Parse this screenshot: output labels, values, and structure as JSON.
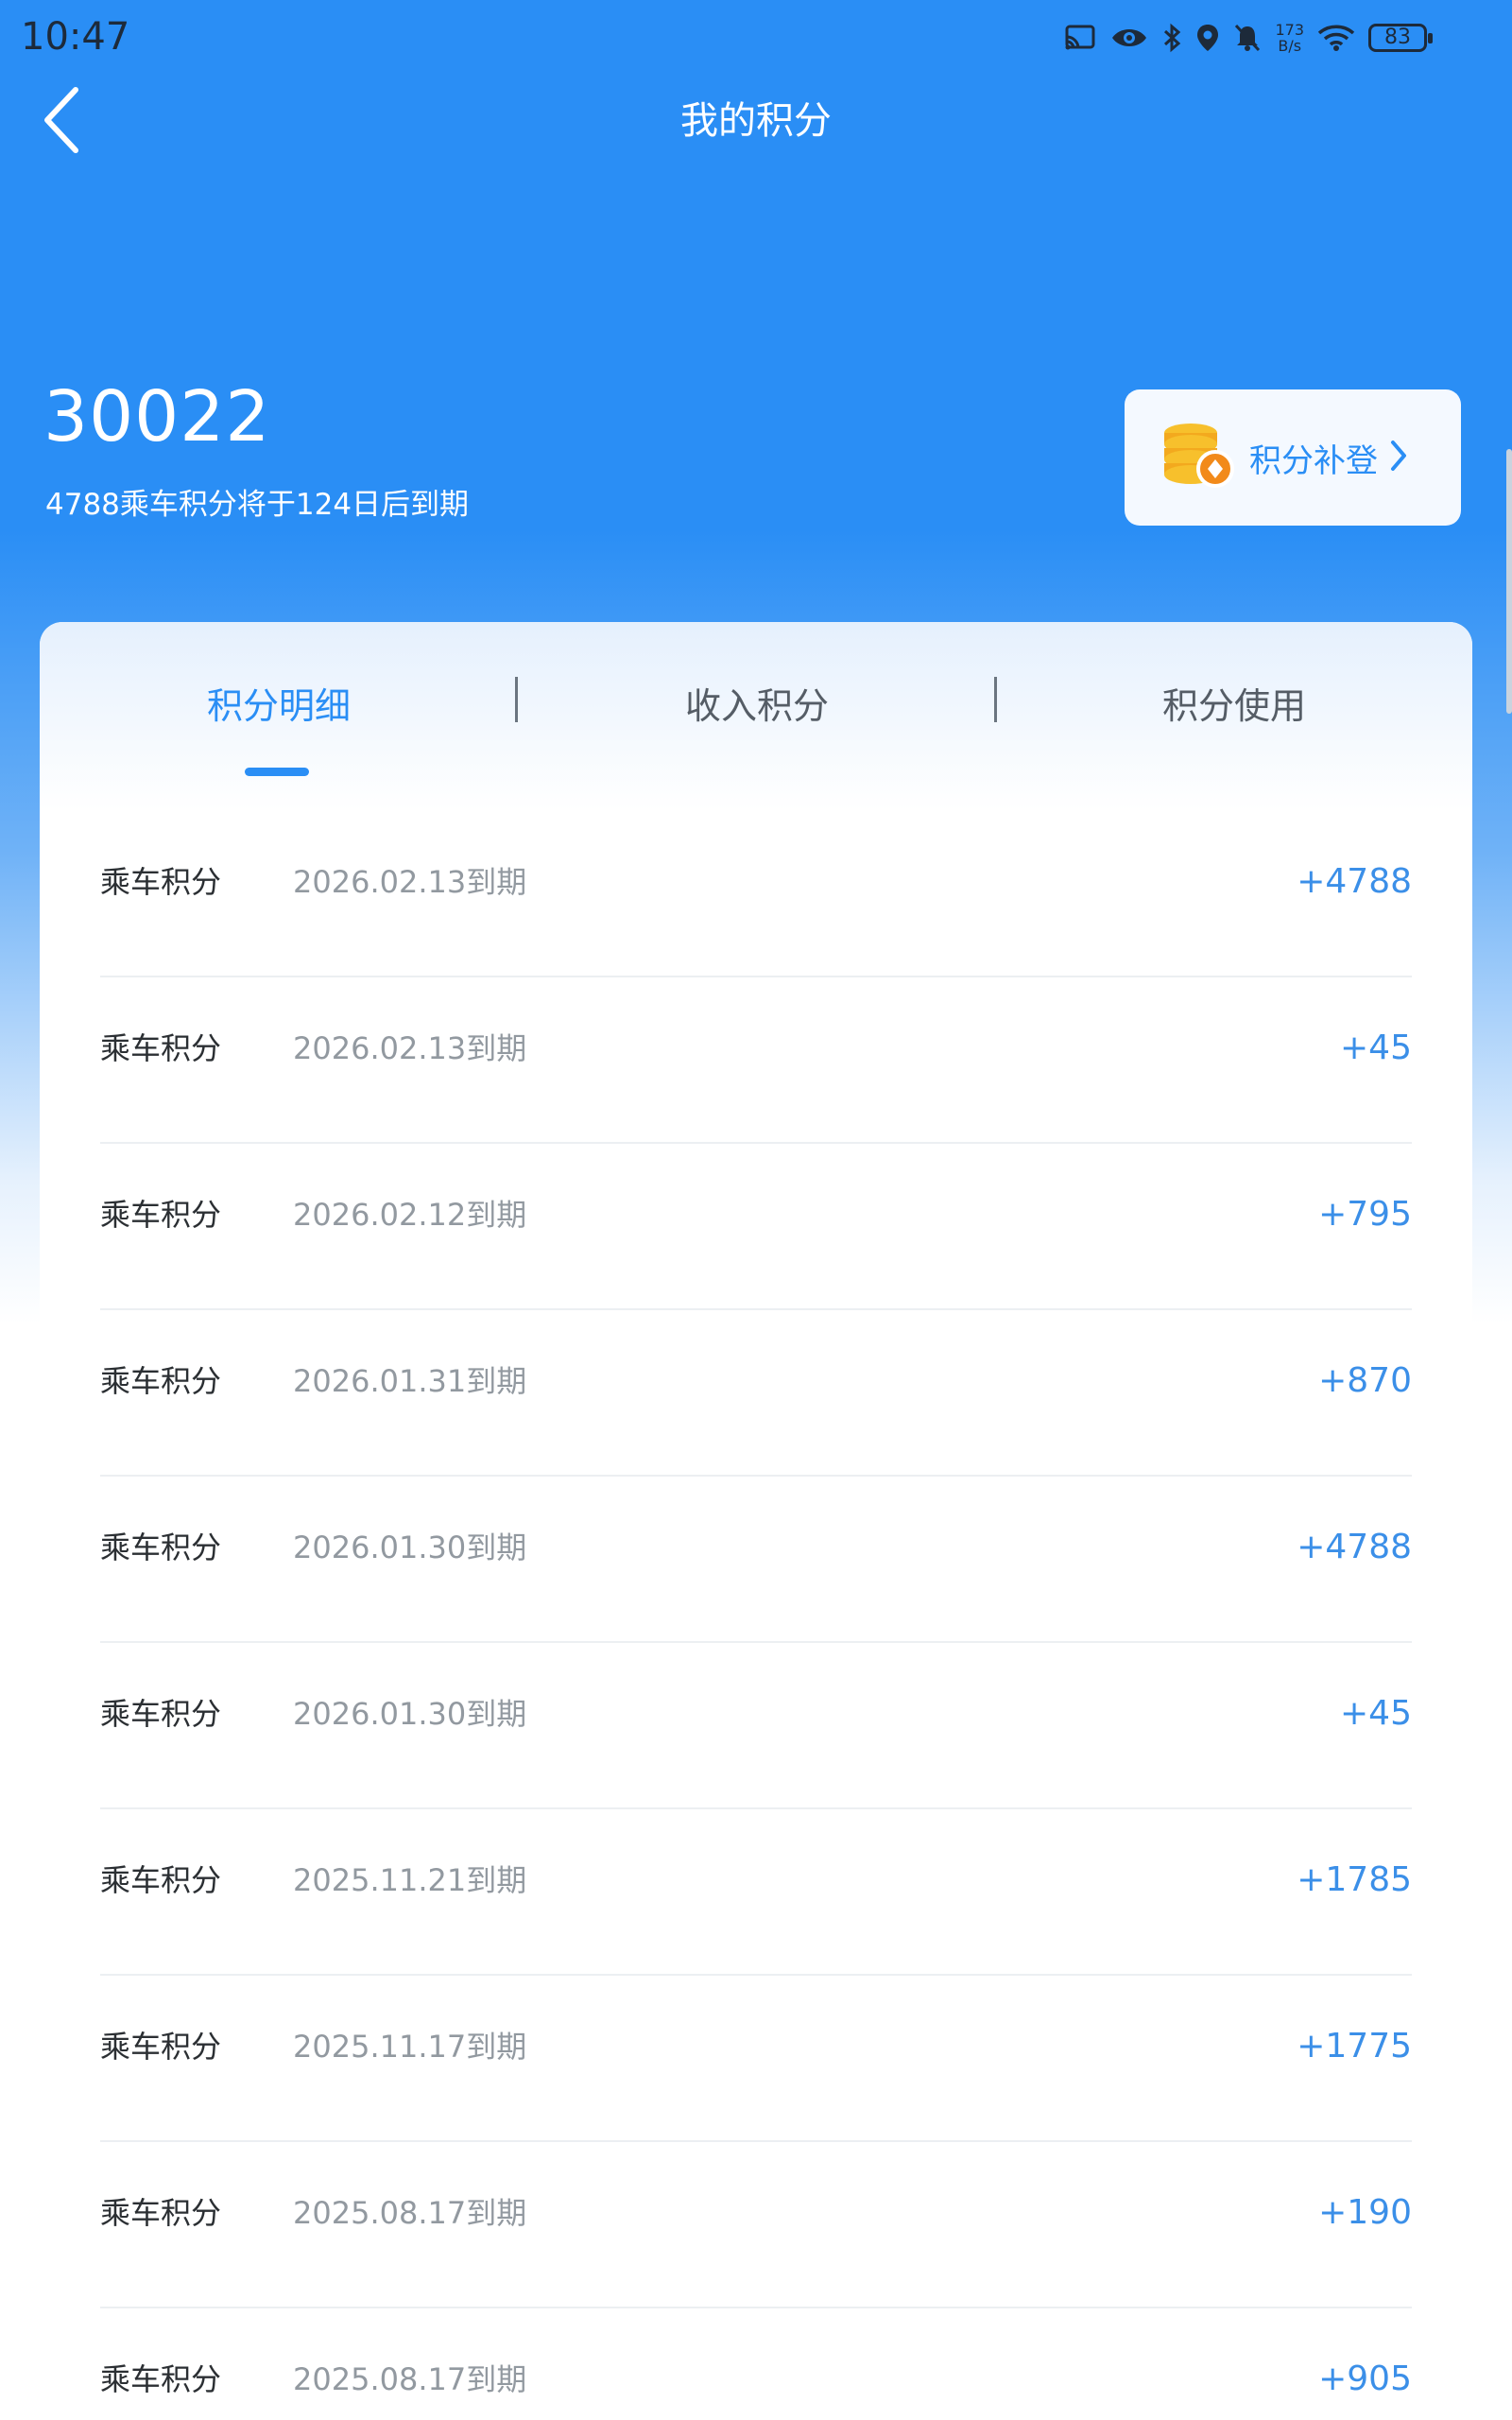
{
  "status_bar": {
    "time": "10:47",
    "net_speed_top": "173",
    "net_speed_bottom": "B/s",
    "battery": "83",
    "icons": [
      "cast-icon",
      "eye-icon",
      "bluetooth-icon",
      "location-icon",
      "mute-icon",
      "wifi-icon",
      "battery-icon"
    ]
  },
  "header": {
    "title": "我的积分",
    "back_icon": "chevron-left-icon"
  },
  "summary": {
    "total_points": "30022",
    "expiry_notice": "4788乘车积分将于124日后到期",
    "makeup_button_label": "积分补登",
    "makeup_icon": "coins-icon"
  },
  "tabs": [
    {
      "label": "积分明细",
      "active": true
    },
    {
      "label": "收入积分",
      "active": false
    },
    {
      "label": "积分使用",
      "active": false
    }
  ],
  "records": [
    {
      "type": "乘车积分",
      "expiry": "2026.02.13到期",
      "amount": "+4788"
    },
    {
      "type": "乘车积分",
      "expiry": "2026.02.13到期",
      "amount": "+45"
    },
    {
      "type": "乘车积分",
      "expiry": "2026.02.12到期",
      "amount": "+795"
    },
    {
      "type": "乘车积分",
      "expiry": "2026.01.31到期",
      "amount": "+870"
    },
    {
      "type": "乘车积分",
      "expiry": "2026.01.30到期",
      "amount": "+4788"
    },
    {
      "type": "乘车积分",
      "expiry": "2026.01.30到期",
      "amount": "+45"
    },
    {
      "type": "乘车积分",
      "expiry": "2025.11.21到期",
      "amount": "+1785"
    },
    {
      "type": "乘车积分",
      "expiry": "2025.11.17到期",
      "amount": "+1775"
    },
    {
      "type": "乘车积分",
      "expiry": "2025.08.17到期",
      "amount": "+190"
    },
    {
      "type": "乘车积分",
      "expiry": "2025.08.17到期",
      "amount": "+905"
    }
  ],
  "colors": {
    "primary": "#2a8ef5",
    "amount": "#3b8fe8",
    "text_dark": "#2b2f33",
    "text_muted": "#9299a0"
  }
}
